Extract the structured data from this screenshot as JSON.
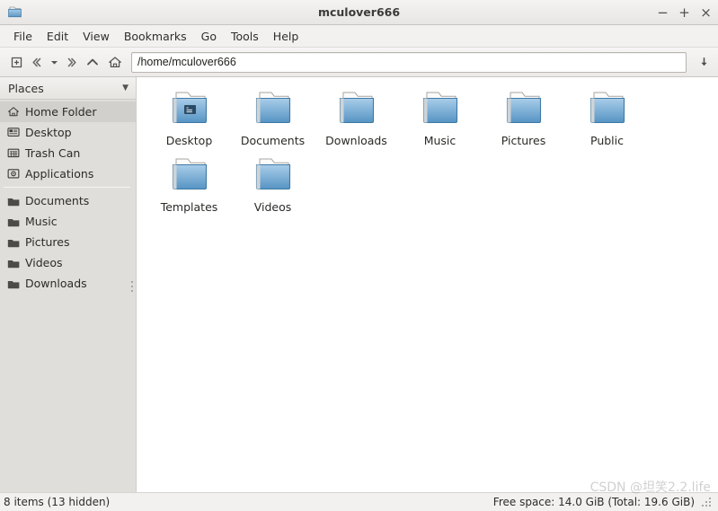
{
  "window": {
    "title": "mculover666",
    "icon": "folder-icon",
    "buttons": {
      "minimize": "−",
      "maximize": "+",
      "close": "×"
    }
  },
  "menubar": {
    "items": [
      {
        "label": "File"
      },
      {
        "label": "Edit"
      },
      {
        "label": "View"
      },
      {
        "label": "Bookmarks"
      },
      {
        "label": "Go"
      },
      {
        "label": "Tools"
      },
      {
        "label": "Help"
      }
    ]
  },
  "toolbar": {
    "buttons": [
      {
        "name": "new-tab-icon",
        "glyph": "➕"
      },
      {
        "name": "back-icon",
        "glyph": "«"
      },
      {
        "name": "history-dropdown-icon",
        "glyph": "▾"
      },
      {
        "name": "forward-icon",
        "glyph": "»"
      },
      {
        "name": "up-icon",
        "glyph": "∧"
      },
      {
        "name": "home-icon",
        "glyph": "⌂"
      }
    ],
    "path_value": "/home/mculover666",
    "path_placeholder": "/home/mculover666",
    "right_button": {
      "name": "go-down-icon",
      "glyph": "⤵"
    }
  },
  "sidebar": {
    "header": "Places",
    "caret": "▼",
    "groups": [
      {
        "items": [
          {
            "label": "Home Folder",
            "icon": "home-icon",
            "selected": true
          },
          {
            "label": "Desktop",
            "icon": "desktop-icon",
            "selected": false
          },
          {
            "label": "Trash Can",
            "icon": "trash-icon",
            "selected": false
          },
          {
            "label": "Applications",
            "icon": "applications-icon",
            "selected": false
          }
        ]
      },
      {
        "items": [
          {
            "label": "Documents",
            "icon": "folder-icon",
            "selected": false
          },
          {
            "label": "Music",
            "icon": "folder-icon",
            "selected": false
          },
          {
            "label": "Pictures",
            "icon": "folder-icon",
            "selected": false
          },
          {
            "label": "Videos",
            "icon": "folder-icon",
            "selected": false
          },
          {
            "label": "Downloads",
            "icon": "folder-icon",
            "selected": false
          }
        ]
      }
    ]
  },
  "files": [
    {
      "label": "Desktop",
      "icon": "folder-desktop-icon"
    },
    {
      "label": "Documents",
      "icon": "folder-icon"
    },
    {
      "label": "Downloads",
      "icon": "folder-icon"
    },
    {
      "label": "Music",
      "icon": "folder-icon"
    },
    {
      "label": "Pictures",
      "icon": "folder-icon"
    },
    {
      "label": "Public",
      "icon": "folder-icon"
    },
    {
      "label": "Templates",
      "icon": "folder-icon"
    },
    {
      "label": "Videos",
      "icon": "folder-icon"
    }
  ],
  "statusbar": {
    "left": "8 items (13 hidden)",
    "right": "Free space: 14.0 GiB (Total: 19.6 GiB)"
  },
  "watermark": "CSDN @坦笑2.2.life",
  "colors": {
    "folder_blue": "#7cb0d8",
    "folder_blue_dark": "#3c78a8",
    "titlebar": "#eeecea",
    "sidebar": "#dfdedb",
    "pane": "#ffffff",
    "selected_row": "#d2d0cc"
  }
}
